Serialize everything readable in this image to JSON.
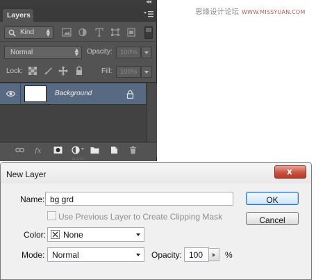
{
  "watermark": {
    "text": "思缘设计论坛",
    "url": "WWW.MISSYUAN.COM"
  },
  "layers_panel": {
    "tab_label": "Layers",
    "filter": {
      "kind_label": "Kind",
      "icons": [
        "pixel-filter-icon",
        "adjustment-filter-icon",
        "type-filter-icon",
        "shape-filter-icon",
        "smart-object-filter-icon"
      ]
    },
    "blend_mode": "Normal",
    "opacity_label": "Opacity:",
    "opacity_value": "100%",
    "lock_label": "Lock:",
    "fill_label": "Fill:",
    "fill_value": "100%",
    "layers": [
      {
        "name": "Background",
        "visible": true,
        "locked": true
      }
    ],
    "bottom_icons": [
      "link-icon",
      "fx-icon",
      "mask-icon",
      "adjustment-icon",
      "folder-icon",
      "new-layer-icon",
      "trash-icon"
    ]
  },
  "dialog": {
    "title": "New Layer",
    "close_symbol": "x",
    "name_label": "Name:",
    "name_value": "bg grd",
    "clipping_label": "Use Previous Layer to Create Clipping Mask",
    "clipping_checked": false,
    "color_label": "Color:",
    "color_value": "None",
    "mode_label": "Mode:",
    "mode_value": "Normal",
    "opacity_label": "Opacity:",
    "opacity_value": "100",
    "opacity_unit": "%",
    "ok_label": "OK",
    "cancel_label": "Cancel"
  }
}
